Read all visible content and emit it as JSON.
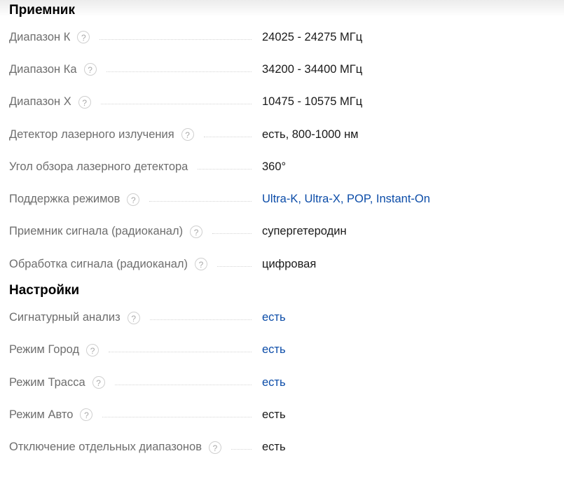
{
  "sections": [
    {
      "title": "Приемник",
      "rows": [
        {
          "name": "Диапазон К",
          "value": "24025 - 24275 МГц",
          "link": false
        },
        {
          "name": "Диапазон Ка",
          "value": "34200 - 34400 МГц",
          "link": false
        },
        {
          "name": "Диапазон Х",
          "value": "10475 - 10575 МГц",
          "link": false
        },
        {
          "name": "Детектор лазерного излучения",
          "value": "есть, 800-1000 нм",
          "link": false
        },
        {
          "name": "Угол обзора лазерного детектора",
          "value": "360°",
          "link": false
        },
        {
          "name": "Поддержка режимов",
          "value": "Ultra-K, Ultra-X, POP, Instant-On",
          "link": true
        },
        {
          "name": "Приемник сигнала (радиоканал)",
          "value": "супергетеродин",
          "link": false
        },
        {
          "name": "Обработка сигнала (радиоканал)",
          "value": "цифровая",
          "link": false
        }
      ]
    },
    {
      "title": "Настройки",
      "rows": [
        {
          "name": "Сигнатурный анализ",
          "value": "есть",
          "link": true
        },
        {
          "name": "Режим Город",
          "value": "есть",
          "link": true
        },
        {
          "name": "Режим Трасса",
          "value": "есть",
          "link": true
        },
        {
          "name": "Режим Авто",
          "value": "есть",
          "link": false
        },
        {
          "name": "Отключение отдельных диапазонов",
          "value": "есть",
          "link": false
        }
      ]
    }
  ],
  "help_glyph": "?",
  "icons": {
    "help": "question-circle-icon"
  },
  "colors": {
    "label": "#6e6e6e",
    "value": "#1a1a1a",
    "link": "#0b4ca8"
  }
}
